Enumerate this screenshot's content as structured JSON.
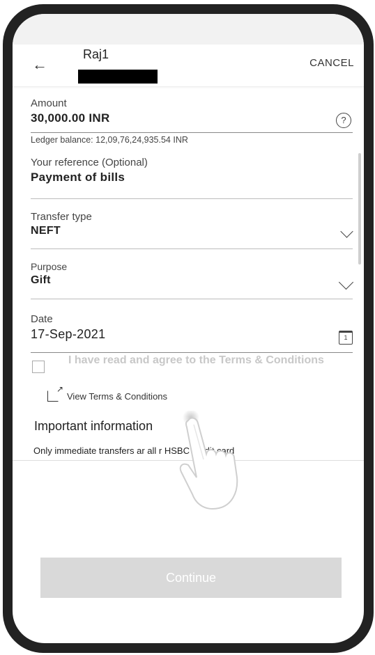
{
  "header": {
    "payee_name": "Raj1",
    "cancel_label": "CANCEL"
  },
  "amount": {
    "label": "Amount",
    "value": "30,000.00 INR",
    "help_icon": "help-circle-icon"
  },
  "ledger_text": "Ledger balance: 12,09,76,24,935.54 INR",
  "reference": {
    "label": "Your reference (Optional)",
    "value": "Payment of bills"
  },
  "transfer_type": {
    "label": "Transfer type",
    "value": "NEFT"
  },
  "purpose": {
    "label": "Purpose",
    "value": "Gift"
  },
  "date": {
    "label": "Date",
    "value": "17-Sep-2021",
    "calendar_day": "1"
  },
  "terms": {
    "agree_text": "I have read and agree to the Terms & Conditions",
    "view_link": "View Terms & Conditions"
  },
  "important": {
    "heading": "Important information",
    "text": "Only immediate transfers ar   all        r HSBC credit card"
  },
  "continue_label": "Continue",
  "colors": {
    "disabled_button": "#d9d9d9",
    "disabled_text": "#c8c8c8",
    "bezel": "#222222"
  }
}
